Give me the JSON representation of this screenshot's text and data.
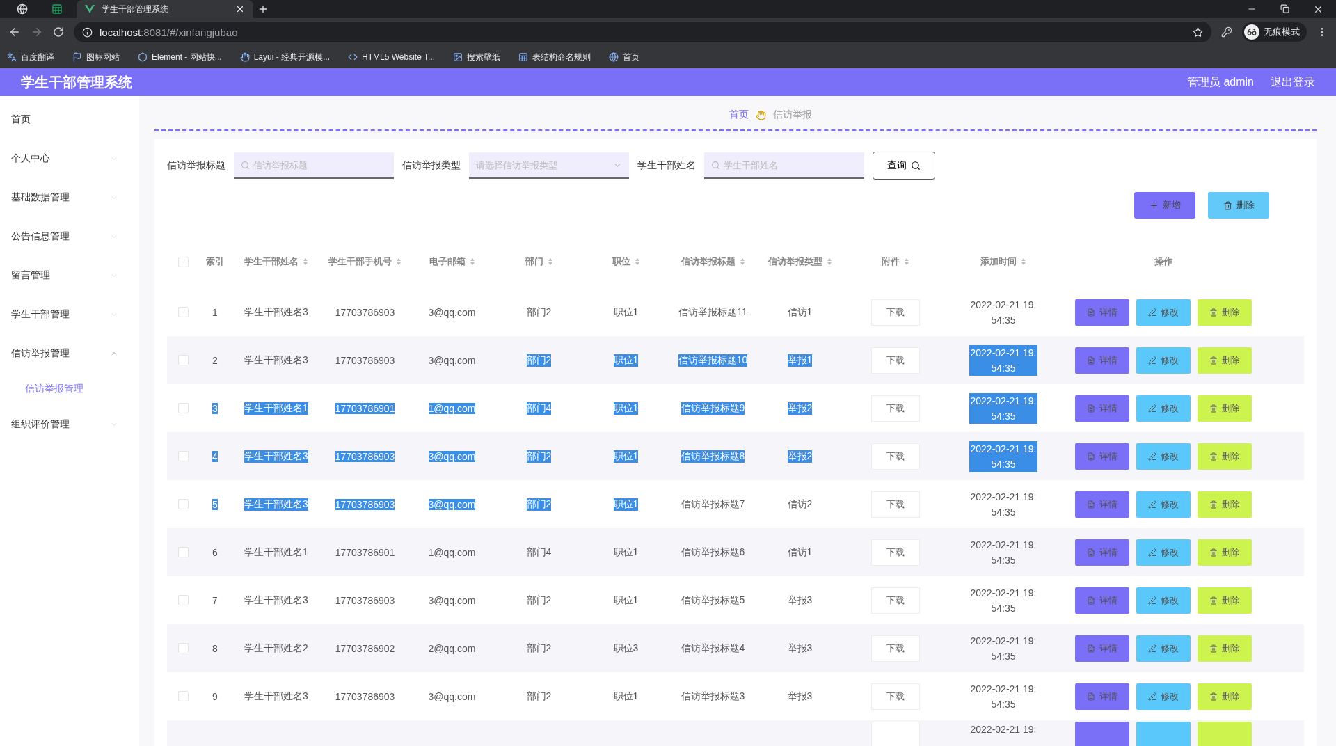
{
  "browser": {
    "tabs": [
      {
        "title": "学生干部管理系统",
        "selected": true
      }
    ],
    "url_host": "localhost",
    "url_rest": ":8081/#/xinfangjubao",
    "profile": "无痕模式",
    "bookmarks": [
      {
        "label": "百度翻译",
        "kind": "translate"
      },
      {
        "label": "图标网站",
        "kind": "flag"
      },
      {
        "label": "Element - 网站快...",
        "kind": "hex"
      },
      {
        "label": "Layui - 经典开源模...",
        "kind": "layui"
      },
      {
        "label": "HTML5 Website T...",
        "kind": "html"
      },
      {
        "label": "搜索壁纸",
        "kind": "wall"
      },
      {
        "label": "表结构命名规则",
        "kind": "sheet"
      },
      {
        "label": "首页",
        "kind": "globe"
      }
    ]
  },
  "header": {
    "title": "学生干部管理系统",
    "user": "管理员 admin",
    "logout": "退出登录"
  },
  "sidebar": {
    "items": [
      {
        "label": "首页"
      },
      {
        "label": "个人中心",
        "expanded": false
      },
      {
        "label": "基础数据管理",
        "expanded": false
      },
      {
        "label": "公告信息管理",
        "expanded": false
      },
      {
        "label": "留言管理",
        "expanded": false
      },
      {
        "label": "学生干部管理",
        "expanded": false
      },
      {
        "label": "信访举报管理",
        "expanded": true,
        "children": [
          {
            "label": "信访举报管理",
            "selected": true
          }
        ]
      },
      {
        "label": "组织评价管理",
        "expanded": false
      }
    ]
  },
  "breadcrumb": {
    "home": "首页",
    "current": "信访举报"
  },
  "filters": [
    {
      "label": "信访举报标题",
      "kind": "text",
      "placeholder": "信访举报标题"
    },
    {
      "label": "信访举报类型",
      "kind": "select",
      "placeholder": "请选择信访举报类型"
    },
    {
      "label": "学生干部姓名",
      "kind": "text",
      "placeholder": "学生干部姓名"
    }
  ],
  "query_button": "查询",
  "toolbar": [
    {
      "label": "新增",
      "kind": "add"
    },
    {
      "label": "删除",
      "kind": "delete"
    }
  ],
  "table": {
    "select_all": {
      "checked": false
    },
    "columns": [
      {
        "label": "索引",
        "sortable": false
      },
      {
        "label": "学生干部姓名",
        "sortable": true
      },
      {
        "label": "学生干部手机号",
        "sortable": true
      },
      {
        "label": "电子邮箱",
        "sortable": true
      },
      {
        "label": "部门",
        "sortable": true
      },
      {
        "label": "职位",
        "sortable": true
      },
      {
        "label": "信访举报标题",
        "sortable": true
      },
      {
        "label": "信访举报类型",
        "sortable": true
      },
      {
        "label": "附件",
        "sortable": true
      },
      {
        "label": "添加时间",
        "sortable": true
      },
      {
        "label": "操作",
        "sortable": false
      }
    ],
    "rows": [
      {
        "kind": "full",
        "checked": false,
        "cells": [
          {
            "text": "1",
            "highlighted": false
          },
          {
            "text": "学生干部姓名3",
            "highlighted": false
          },
          {
            "text": "17703786903",
            "highlighted": false
          },
          {
            "text": "3@qq.com",
            "highlighted": false
          },
          {
            "text": "部门2",
            "highlighted": false
          },
          {
            "text": "职位1",
            "highlighted": false
          },
          {
            "text": "信访举报标题11",
            "highlighted": false
          },
          {
            "text": "信访1",
            "highlighted": false
          }
        ],
        "attachment": "下载",
        "time": {
          "text": "2022-02-21 19:54:35",
          "highlighted": false
        },
        "actions": [
          {
            "label": "详情",
            "kind": "detail"
          },
          {
            "label": "修改",
            "kind": "edit"
          },
          {
            "label": "删除",
            "kind": "delete"
          }
        ]
      },
      {
        "kind": "full",
        "checked": false,
        "cells": [
          {
            "text": "2",
            "highlighted": false
          },
          {
            "text": "学生干部姓名3",
            "highlighted": false
          },
          {
            "text": "17703786903",
            "highlighted": false
          },
          {
            "text": "3@qq.com",
            "highlighted": false
          },
          {
            "text": "部门2",
            "highlighted": true
          },
          {
            "text": "职位1",
            "highlighted": true
          },
          {
            "text": "信访举报标题10",
            "highlighted": true
          },
          {
            "text": "举报1",
            "highlighted": true
          }
        ],
        "attachment": "下载",
        "time": {
          "text": "2022-02-21 19:54:35",
          "highlighted": true
        },
        "actions": [
          {
            "label": "详情",
            "kind": "detail"
          },
          {
            "label": "修改",
            "kind": "edit"
          },
          {
            "label": "删除",
            "kind": "delete"
          }
        ]
      },
      {
        "kind": "full",
        "checked": false,
        "cells": [
          {
            "text": "3",
            "highlighted": true
          },
          {
            "text": "学生干部姓名1",
            "highlighted": true
          },
          {
            "text": "17703786901",
            "highlighted": true
          },
          {
            "text": "1@qq.com",
            "highlighted": true
          },
          {
            "text": "部门4",
            "highlighted": true
          },
          {
            "text": "职位1",
            "highlighted": true
          },
          {
            "text": "信访举报标题9",
            "highlighted": true
          },
          {
            "text": "举报2",
            "highlighted": true
          }
        ],
        "attachment": "下载",
        "time": {
          "text": "2022-02-21 19:54:35",
          "highlighted": true
        },
        "actions": [
          {
            "label": "详情",
            "kind": "detail"
          },
          {
            "label": "修改",
            "kind": "edit"
          },
          {
            "label": "删除",
            "kind": "delete"
          }
        ]
      },
      {
        "kind": "full",
        "checked": false,
        "cells": [
          {
            "text": "4",
            "highlighted": true
          },
          {
            "text": "学生干部姓名3",
            "highlighted": true
          },
          {
            "text": "17703786903",
            "highlighted": true
          },
          {
            "text": "3@qq.com",
            "highlighted": true
          },
          {
            "text": "部门2",
            "highlighted": true
          },
          {
            "text": "职位1",
            "highlighted": true
          },
          {
            "text": "信访举报标题8",
            "highlighted": true
          },
          {
            "text": "举报2",
            "highlighted": true
          }
        ],
        "attachment": "下载",
        "time": {
          "text": "2022-02-21 19:54:35",
          "highlighted": true
        },
        "actions": [
          {
            "label": "详情",
            "kind": "detail"
          },
          {
            "label": "修改",
            "kind": "edit"
          },
          {
            "label": "删除",
            "kind": "delete"
          }
        ]
      },
      {
        "kind": "full",
        "checked": false,
        "cells": [
          {
            "text": "5",
            "highlighted": true
          },
          {
            "text": "学生干部姓名3",
            "highlighted": true
          },
          {
            "text": "17703786903",
            "highlighted": true
          },
          {
            "text": "3@qq.com",
            "highlighted": true
          },
          {
            "text": "部门2",
            "highlighted": true
          },
          {
            "text": "职位1",
            "highlighted": true
          },
          {
            "text": "信访举报标题7",
            "highlighted": false
          },
          {
            "text": "信访2",
            "highlighted": false
          }
        ],
        "attachment": "下载",
        "time": {
          "text": "2022-02-21 19:54:35",
          "highlighted": false
        },
        "actions": [
          {
            "label": "详情",
            "kind": "detail"
          },
          {
            "label": "修改",
            "kind": "edit"
          },
          {
            "label": "删除",
            "kind": "delete"
          }
        ]
      },
      {
        "kind": "full",
        "checked": false,
        "cells": [
          {
            "text": "6",
            "highlighted": false
          },
          {
            "text": "学生干部姓名1",
            "highlighted": false
          },
          {
            "text": "17703786901",
            "highlighted": false
          },
          {
            "text": "1@qq.com",
            "highlighted": false
          },
          {
            "text": "部门4",
            "highlighted": false
          },
          {
            "text": "职位1",
            "highlighted": false
          },
          {
            "text": "信访举报标题6",
            "highlighted": false
          },
          {
            "text": "信访1",
            "highlighted": false
          }
        ],
        "attachment": "下载",
        "time": {
          "text": "2022-02-21 19:54:35",
          "highlighted": false
        },
        "actions": [
          {
            "label": "详情",
            "kind": "detail"
          },
          {
            "label": "修改",
            "kind": "edit"
          },
          {
            "label": "删除",
            "kind": "delete"
          }
        ]
      },
      {
        "kind": "full",
        "checked": false,
        "cells": [
          {
            "text": "7",
            "highlighted": false
          },
          {
            "text": "学生干部姓名3",
            "highlighted": false
          },
          {
            "text": "17703786903",
            "highlighted": false
          },
          {
            "text": "3@qq.com",
            "highlighted": false
          },
          {
            "text": "部门2",
            "highlighted": false
          },
          {
            "text": "职位1",
            "highlighted": false
          },
          {
            "text": "信访举报标题5",
            "highlighted": false
          },
          {
            "text": "举报3",
            "highlighted": false
          }
        ],
        "attachment": "下载",
        "time": {
          "text": "2022-02-21 19:54:35",
          "highlighted": false
        },
        "actions": [
          {
            "label": "详情",
            "kind": "detail"
          },
          {
            "label": "修改",
            "kind": "edit"
          },
          {
            "label": "删除",
            "kind": "delete"
          }
        ]
      },
      {
        "kind": "full",
        "checked": false,
        "cells": [
          {
            "text": "8",
            "highlighted": false
          },
          {
            "text": "学生干部姓名2",
            "highlighted": false
          },
          {
            "text": "17703786902",
            "highlighted": false
          },
          {
            "text": "2@qq.com",
            "highlighted": false
          },
          {
            "text": "部门2",
            "highlighted": false
          },
          {
            "text": "职位3",
            "highlighted": false
          },
          {
            "text": "信访举报标题4",
            "highlighted": false
          },
          {
            "text": "举报3",
            "highlighted": false
          }
        ],
        "attachment": "下载",
        "time": {
          "text": "2022-02-21 19:54:35",
          "highlighted": false
        },
        "actions": [
          {
            "label": "详情",
            "kind": "detail"
          },
          {
            "label": "修改",
            "kind": "edit"
          },
          {
            "label": "删除",
            "kind": "delete"
          }
        ]
      },
      {
        "kind": "full",
        "checked": false,
        "cells": [
          {
            "text": "9",
            "highlighted": false
          },
          {
            "text": "学生干部姓名3",
            "highlighted": false
          },
          {
            "text": "17703786903",
            "highlighted": false
          },
          {
            "text": "3@qq.com",
            "highlighted": false
          },
          {
            "text": "部门2",
            "highlighted": false
          },
          {
            "text": "职位1",
            "highlighted": false
          },
          {
            "text": "信访举报标题3",
            "highlighted": false
          },
          {
            "text": "举报3",
            "highlighted": false
          }
        ],
        "attachment": "下载",
        "time": {
          "text": "2022-02-21 19:54:35",
          "highlighted": false
        },
        "actions": [
          {
            "label": "详情",
            "kind": "detail"
          },
          {
            "label": "修改",
            "kind": "edit"
          },
          {
            "label": "删除",
            "kind": "delete"
          }
        ]
      },
      {
        "kind": "cut",
        "time": {
          "text": "2022-02-21 19:",
          "highlighted": false
        }
      }
    ]
  }
}
